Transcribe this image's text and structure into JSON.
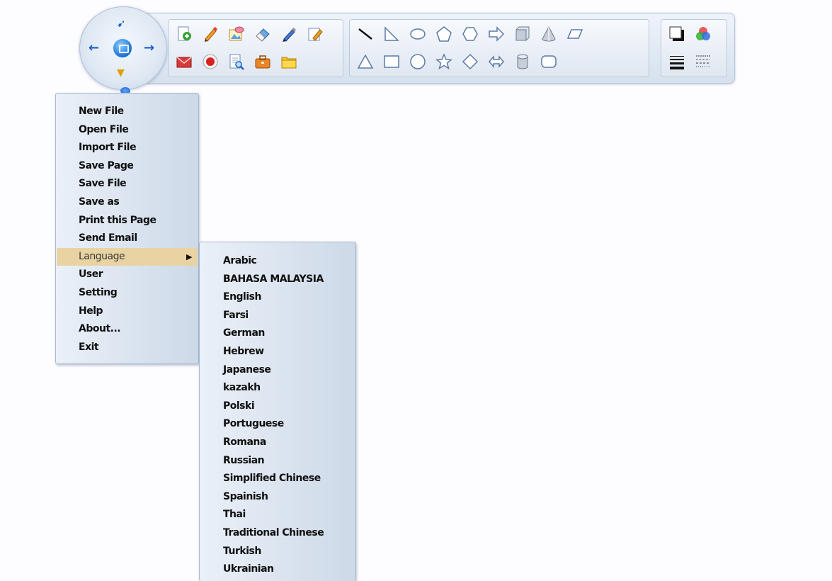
{
  "toolbar": {
    "row1_tools": [
      "new-page-icon",
      "pencil-icon",
      "insert-image-icon",
      "eraser-icon",
      "marker-icon",
      "edit-icon"
    ],
    "row2_tools": [
      "mail-icon",
      "record-icon",
      "search-document-icon",
      "toolbox-icon",
      "folder-icon"
    ],
    "row1_shapes": [
      "line-icon",
      "right-triangle-icon",
      "ellipse-icon",
      "pentagon-icon",
      "hexagon-icon",
      "right-arrow-icon",
      "cube-icon",
      "cone-icon",
      "parallelogram-icon"
    ],
    "row2_shapes": [
      "triangle-icon",
      "rectangle-icon",
      "circle-icon",
      "star-icon",
      "diamond-icon",
      "double-arrow-icon",
      "cylinder-icon",
      "rounded-rectangle-icon"
    ],
    "style_tools": [
      "shadow-icon",
      "color-palette-icon",
      "line-thickness-icon",
      "line-style-icon"
    ]
  },
  "file_menu": {
    "items": [
      "New File",
      "Open File",
      "Import File",
      "Save Page",
      "Save File",
      "Save as",
      "Print this Page",
      "Send Email",
      "Language",
      "User",
      "Setting",
      "Help",
      "About...",
      "Exit"
    ],
    "highlighted": "Language"
  },
  "language_menu": {
    "items": [
      "Arabic",
      "BAHASA MALAYSIA",
      "English",
      "Farsi",
      "German",
      "Hebrew",
      "Japanese",
      "kazakh",
      "Polski",
      "Portuguese",
      "Romana",
      "Russian",
      "Simplified Chinese",
      "Spainish",
      "Thai",
      "Traditional Chinese",
      "Turkish",
      "Ukrainian"
    ]
  },
  "colors": {
    "highlight": "#e9d3a2",
    "accent": "#1b6fd6"
  }
}
